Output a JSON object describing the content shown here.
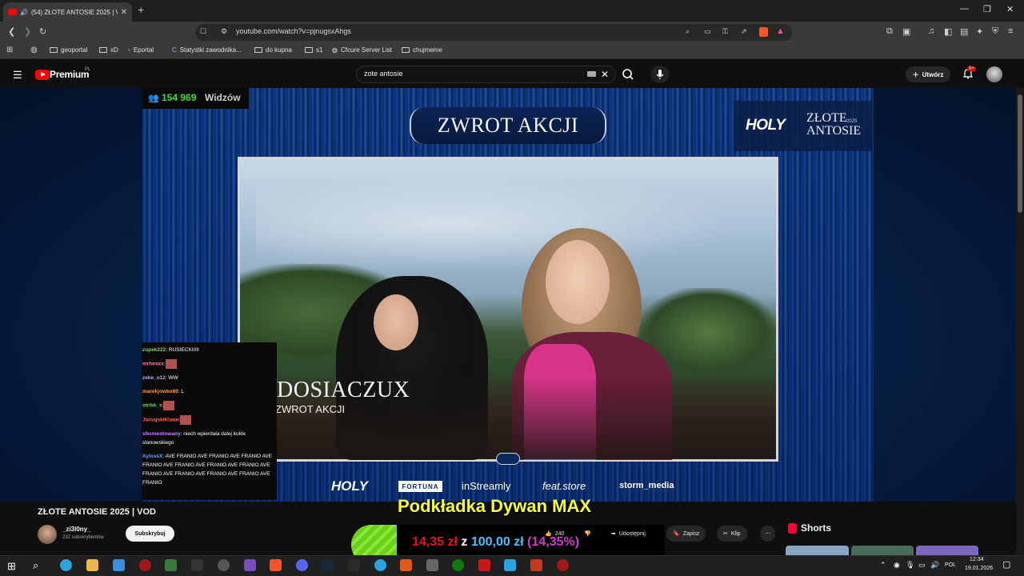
{
  "browser": {
    "tab_title": "(54) ZŁOTE ANTOSIE 2025 | V",
    "new_tab": "+",
    "url": "youtube.com/watch?v=pjnugsxAhgs",
    "window_controls": [
      "—",
      "❐",
      "✕"
    ],
    "bookmarks": [
      {
        "label": "geoportal",
        "icon": "folder-icon"
      },
      {
        "label": "xD",
        "icon": "folder-icon"
      },
      {
        "label": "Eportal",
        "icon": "site-icon"
      },
      {
        "label": "Statystki zawodnika...",
        "icon": "site-icon"
      },
      {
        "label": "do kupna",
        "icon": "folder-icon"
      },
      {
        "label": "s1",
        "icon": "folder-icon"
      },
      {
        "label": "Cfcure Server List",
        "icon": "site-icon"
      },
      {
        "label": "chujmeme",
        "icon": "folder-icon"
      }
    ]
  },
  "youtube": {
    "logo_text": "Premium",
    "region": "PL",
    "search_value": "zote antosie",
    "create_label": "Utwórz",
    "notifications_badge": "9+"
  },
  "video": {
    "viewers_count": "154 969",
    "viewers_label": "Widzów",
    "banner": "ZWROT AKCJI",
    "brand_holy": "HOLY",
    "brand_line1": "ZŁOTE",
    "brand_line2": "ANTOSIE",
    "brand_year": "2025",
    "nominee_name": "DOSIACZUX",
    "nominee_category": "ZWROT AKCJI",
    "sponsors": {
      "holy": "HOLY",
      "fortuna": "FORTUNA",
      "instreamly": "inStreamly",
      "feat": "feat.store",
      "storm": "storm_media"
    },
    "chat": [
      {
        "user": "zupek222",
        "color": "#7ad67a",
        "text": ": RUSIECKIIIII",
        "emote": false
      },
      {
        "user": "mrhexxx",
        "color": "#ff7fb0",
        "text": ":",
        "emote": true
      },
      {
        "user": "zeke_o12",
        "color": "#b0b0ff",
        "text": ": WW",
        "emote": false
      },
      {
        "user": "marekjowko69",
        "color": "#ff9a3c",
        "text": ": L",
        "emote": false
      },
      {
        "user": "strikk_s",
        "color": "#6bd16b",
        "text": ":",
        "emote": true
      },
      {
        "user": "JamajskiKlaun",
        "color": "#ff5f5f",
        "text": ":",
        "emote": true
      },
      {
        "user": "sfermentowany",
        "color": "#c080ff",
        "text": ": niech wpierdala dalej kukle stanowskiego",
        "emote": false
      },
      {
        "user": "XylossX",
        "color": "#6aa8ff",
        "text": ": AVE FRANIO AVE FRANIO AVE FRANIO AVE FRANIO AVE FRANIO AVE FRANIO AVE FRANIO AVE FRANIO AVE FRANIO AVE FRANIO AVE FRANIO AVE FRANIO",
        "emote": false
      }
    ]
  },
  "below": {
    "title": "ZŁOTE ANTOSIE 2025 | VOD",
    "channel_name": "_zi3l0ny_",
    "channel_subs": "232 subskrybentów",
    "subscribe_label": "Subskrybuj",
    "likes": "240",
    "share_label": "Udostępnij",
    "save_label": "Zapisz",
    "clip_label": "Klip",
    "more_label": "⋯",
    "shorts_label": "Shorts"
  },
  "promo": {
    "title": "Podkładka Dywan MAX",
    "amount": "14,35 zł",
    "sep": "z",
    "goal": "100,00 zł",
    "percent": "(14,35%)",
    "progress_fraction": 0.1435
  },
  "taskbar": {
    "time": "12:34",
    "date": "19.01.2026",
    "lang": "POL"
  },
  "colors": {
    "youtube_red": "#ff0000",
    "viewers_green": "#35e12f",
    "promo_yellow": "#f5ff3a",
    "promo_red": "#e0161b",
    "promo_blue": "#49c3ff",
    "promo_pink": "#d23ec8"
  }
}
